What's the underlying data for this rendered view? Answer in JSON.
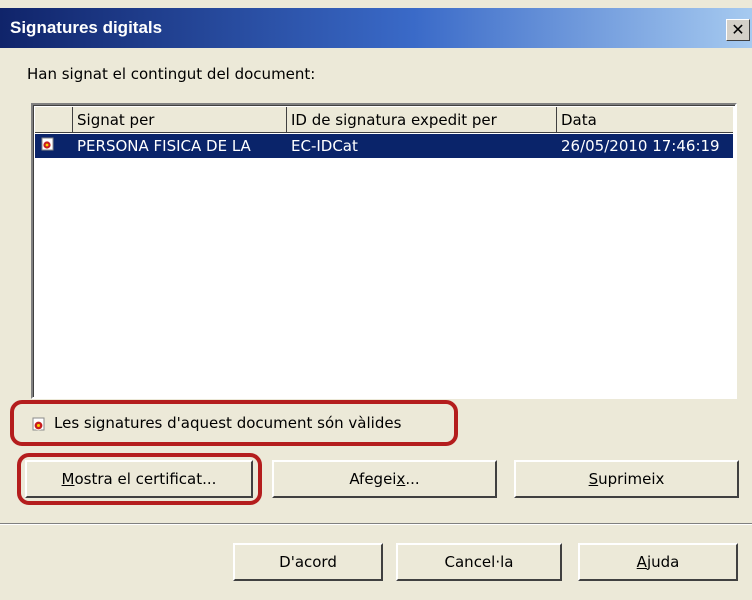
{
  "dialog": {
    "title": "Signatures digitals",
    "prompt": "Han signat el contingut del document:"
  },
  "list": {
    "headers": [
      "Signat per",
      "ID de signatura expedit per",
      "Data"
    ],
    "rows": [
      {
        "signed_by": "PERSONA FISICA DE LA",
        "issued_by": "EC-IDCat",
        "date": "26/05/2010 17:46:19"
      }
    ]
  },
  "status": {
    "text": "Les signatures d'aquest document són vàlides",
    "icon": "signature-seal-icon"
  },
  "buttons": {
    "show_cert": {
      "pre": "",
      "key": "M",
      "post": "ostra el certificat..."
    },
    "add": {
      "pre": "Afegei",
      "key": "x",
      "post": "..."
    },
    "remove": {
      "pre": "",
      "key": "S",
      "post": "uprimeix"
    },
    "ok": "D'acord",
    "cancel": "Cancel·la",
    "help": {
      "pre": "",
      "key": "A",
      "post": "juda"
    }
  },
  "colors": {
    "selection": "#0a246a",
    "annotation": "#b41d1d"
  }
}
